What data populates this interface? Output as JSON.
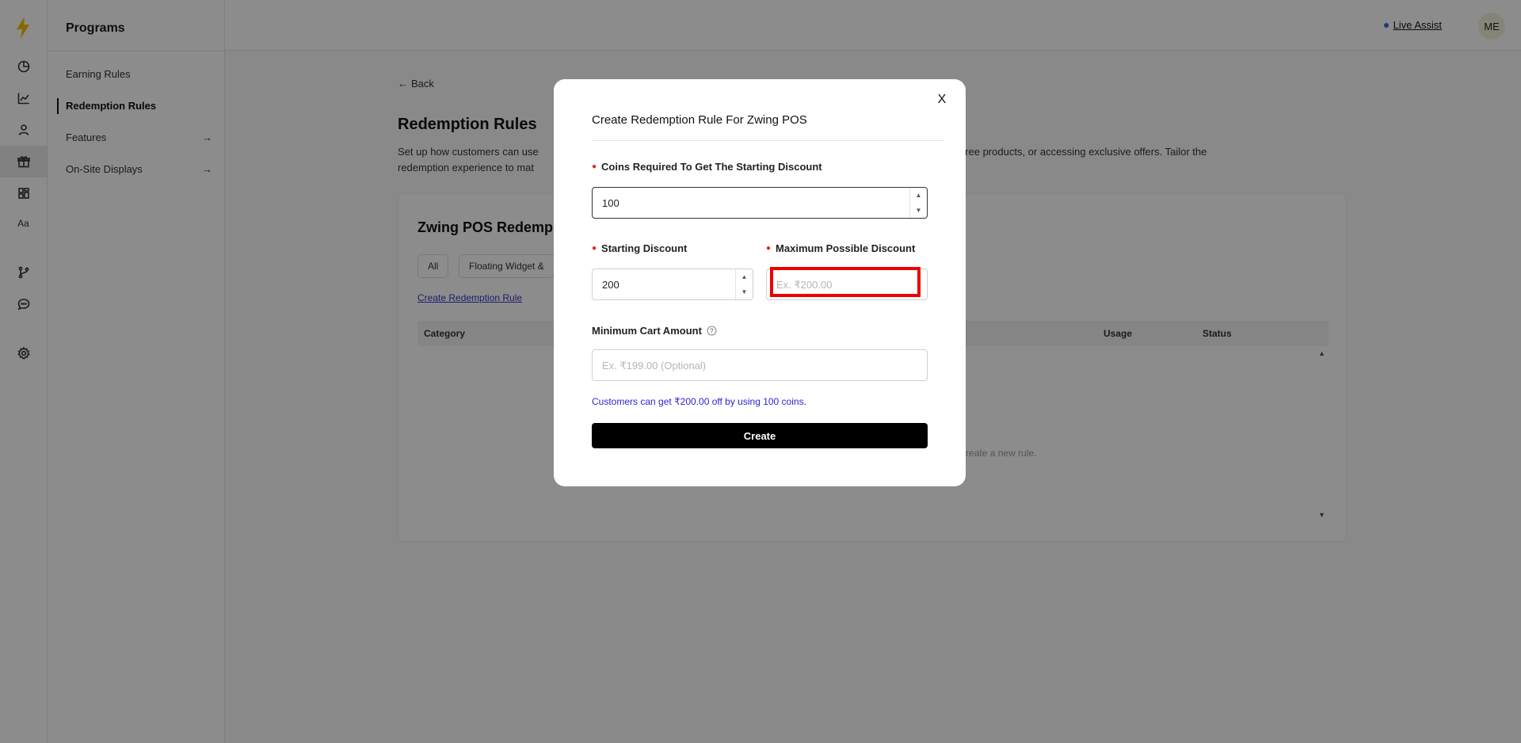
{
  "rail": {
    "items": [
      "dashboard-icon",
      "analytics-icon",
      "customers-icon",
      "programs-icon",
      "widgets-icon",
      "branding-icon",
      "integrations-icon",
      "support-icon",
      "settings-icon"
    ],
    "aa_label": "Aa"
  },
  "subnav": {
    "title": "Programs",
    "items": [
      {
        "label": "Earning Rules"
      },
      {
        "label": "Redemption Rules"
      },
      {
        "label": "Features"
      },
      {
        "label": "On-Site Displays"
      }
    ]
  },
  "topbar": {
    "live_assist": "Live Assist",
    "avatar": "ME"
  },
  "page": {
    "back": "Back",
    "title": "Redemption Rules",
    "description": "Set up how customers can use ",
    "description_2": "ocking free products, or accessing exclusive offers. Tailor the",
    "description_3": "redemption experience to mat",
    "card_title": "Zwing POS Redemp",
    "chips": [
      "All",
      "Floating Widget &"
    ],
    "create_link": "Create Redemption Rule",
    "columns": {
      "category": "Category",
      "usage": "Usage",
      "status": "Status"
    },
    "empty_text": "on to create a new rule."
  },
  "modal": {
    "title": "Create Redemption Rule For Zwing POS",
    "coins_label": "Coins Required To Get The Starting Discount",
    "coins_value": "100",
    "starting_label": "Starting Discount",
    "starting_value": "200",
    "max_label": "Maximum Possible Discount",
    "max_placeholder": "Ex. ₹200.00",
    "min_cart_label": "Minimum Cart Amount",
    "min_cart_placeholder": "Ex. ₹199.00 (Optional)",
    "info_text": "Customers can get ₹200.00 off by using 100 coins.",
    "create_label": "Create",
    "close": "X"
  }
}
